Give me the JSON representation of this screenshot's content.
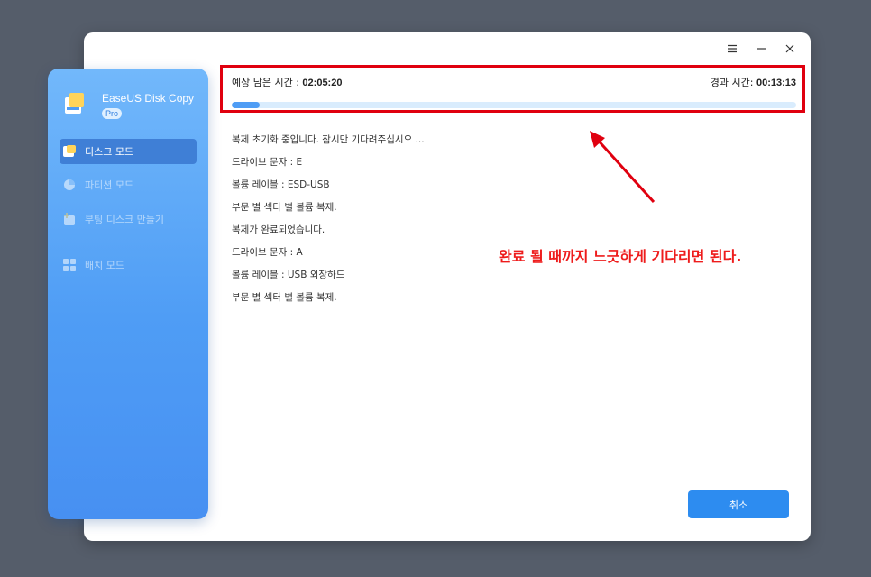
{
  "window": {
    "menu_icon": "menu-icon",
    "minimize_icon": "minimize-icon",
    "close_icon": "close-icon"
  },
  "sidebar": {
    "brand": {
      "name": "EaseUS Disk Copy",
      "badge": "Pro"
    },
    "items": [
      {
        "label": "디스크 모드",
        "icon": "disk-mode-icon",
        "active": true
      },
      {
        "label": "파티션 모드",
        "icon": "partition-mode-icon",
        "active": false
      },
      {
        "label": "부팅 디스크 만들기",
        "icon": "boot-disk-icon",
        "active": false
      },
      {
        "label": "배치 모드",
        "icon": "batch-mode-icon",
        "active": false
      }
    ]
  },
  "progress": {
    "remaining_label": "예상 남은 시간 : ",
    "remaining_value": "02:05:20",
    "elapsed_label": "경과 시간: ",
    "elapsed_value": "00:13:13",
    "percent": 5
  },
  "log": [
    "복제 초기화 중입니다. 잠시만 기다려주십시오 ...",
    "드라이브 문자 : E",
    "볼륨 레이블 : ESD-USB",
    "부문 별 섹터 별 볼륨 복제.",
    "복제가 완료되었습니다.",
    "드라이브 문자 : A",
    "볼륨 레이블 : USB 외장하드",
    "부문 별 섹터 별 볼륨 복제."
  ],
  "annotation": "완료 될 때까지 느긋하게 기다리면 된다.",
  "cancel_label": "취소",
  "colors": {
    "accent": "#4f9df5",
    "highlight": "#e0000f",
    "annotation": "#ee1c1c"
  }
}
